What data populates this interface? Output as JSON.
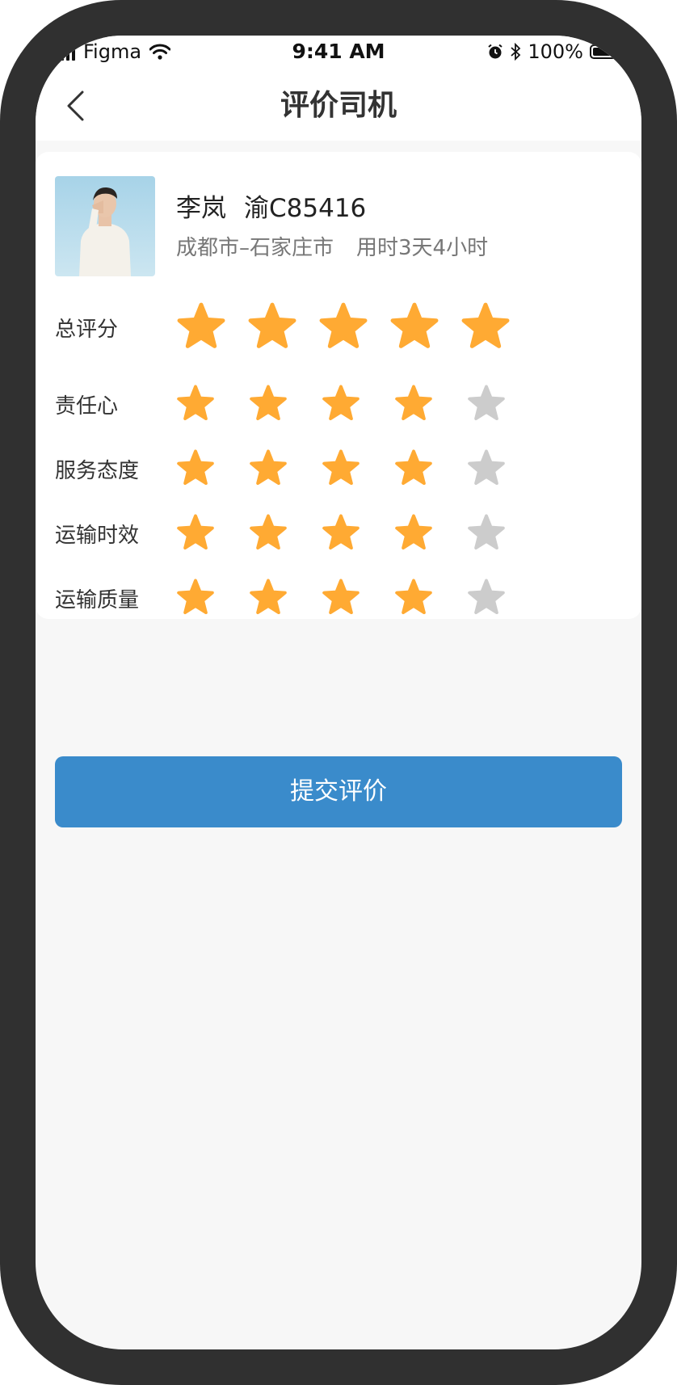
{
  "status_bar": {
    "carrier": "Figma",
    "time": "9:41 AM",
    "battery": "100%"
  },
  "nav": {
    "title": "评价司机"
  },
  "driver": {
    "name": "李岚",
    "plate": "渝C85416",
    "route": "成都市–石家庄市",
    "duration": "用时3天4小时"
  },
  "ratings": [
    {
      "label": "总评分",
      "score": 5,
      "max": 5
    },
    {
      "label": "责任心",
      "score": 4,
      "max": 5
    },
    {
      "label": "服务态度",
      "score": 4,
      "max": 5
    },
    {
      "label": "运输时效",
      "score": 4,
      "max": 5
    },
    {
      "label": "运输质量",
      "score": 4,
      "max": 5
    }
  ],
  "submit_label": "提交评价",
  "colors": {
    "star_on": "#ffaa33",
    "star_off": "#cccccc",
    "primary": "#3a8bcb"
  }
}
